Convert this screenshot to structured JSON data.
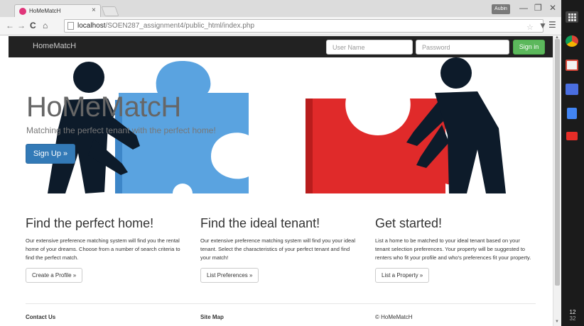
{
  "browser": {
    "tab_title": "HoMeMatcH",
    "tab_close": "×",
    "user_badge": "Aubin",
    "url_host": "localhost",
    "url_path": "/SOEN287_assignment4/public_html/index.php",
    "icons": [
      "back-icon",
      "forward-icon",
      "reload-icon",
      "home-icon",
      "page-icon",
      "star-icon",
      "menu-icon",
      "minimize-icon",
      "restore-icon",
      "close-icon"
    ]
  },
  "navbar": {
    "brand": "HomeMatcH",
    "username_placeholder": "User Name",
    "password_placeholder": "Password",
    "signin_label": "Sign in",
    "signin_color": "#5cb85c"
  },
  "hero": {
    "title": "HoMeMatcH",
    "subtitle": "Matching the perfect tenant with the perfect home!",
    "signup_label": "Sign Up »",
    "puzzle_colors": {
      "blue": "#5aa3e0",
      "red": "#e02a2a",
      "figure": "#0d1b2a"
    }
  },
  "columns": [
    {
      "heading": "Find the perfect home!",
      "body": "Our extensive preference matching system will find you the rental home of your dreams. Choose from a number of search criteria to find the perfect match.",
      "button": "Create a Profile »"
    },
    {
      "heading": "Find the ideal tenant!",
      "body": "Our extensive preference matching system will find you your ideal tenant. Select the characteristics of your perfect tenant and find your match!",
      "button": "List Preferences »"
    },
    {
      "heading": "Get started!",
      "body": "List a home to be matched to your ideal tenant based on your tenant selection preferences. Your property will be suggested to renters who fit your profile and who's preferences fit your property.",
      "button": "List a Property »"
    }
  ],
  "footer": {
    "contact": "Contact Us",
    "sitemap": "Site Map",
    "copyright": "© HoMeMatcH"
  },
  "taskbar": {
    "clock_hour": "12",
    "clock_minute": "32",
    "apps": [
      "apps-grid-icon",
      "chrome-icon",
      "gmail-icon",
      "google-plus-icon",
      "docs-icon",
      "youtube-icon"
    ]
  }
}
